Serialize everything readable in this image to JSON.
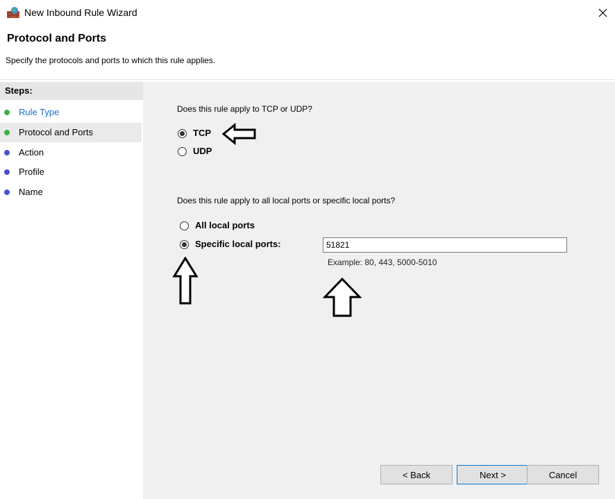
{
  "window": {
    "title": "New Inbound Rule Wizard"
  },
  "header": {
    "title": "Protocol and Ports",
    "description": "Specify the protocols and ports to which this rule applies."
  },
  "steps": {
    "heading": "Steps:",
    "items": [
      {
        "label": "Rule Type",
        "state": "completed-link",
        "dot_color": "#3cb043"
      },
      {
        "label": "Protocol and Ports",
        "state": "current",
        "dot_color": "#3cb043"
      },
      {
        "label": "Action",
        "state": "pending",
        "dot_color": "#4b4fcf"
      },
      {
        "label": "Profile",
        "state": "pending",
        "dot_color": "#4b4fcf"
      },
      {
        "label": "Name",
        "state": "pending",
        "dot_color": "#4b4fcf"
      }
    ]
  },
  "protocol": {
    "question": "Does this rule apply to TCP or UDP?",
    "options": [
      {
        "label": "TCP",
        "checked": true
      },
      {
        "label": "UDP",
        "checked": false
      }
    ]
  },
  "ports": {
    "question": "Does this rule apply to all local ports or specific local ports?",
    "options": [
      {
        "label": "All local ports",
        "checked": false
      },
      {
        "label": "Specific local ports:",
        "checked": true
      }
    ],
    "value": "51821",
    "example": "Example: 80, 443, 5000-5010"
  },
  "buttons": {
    "back": "< Back",
    "next": "Next >",
    "cancel": "Cancel"
  },
  "icons": {
    "app": "firewall-icon",
    "close": "close-icon",
    "annotation": "outline-arrow-icon"
  }
}
